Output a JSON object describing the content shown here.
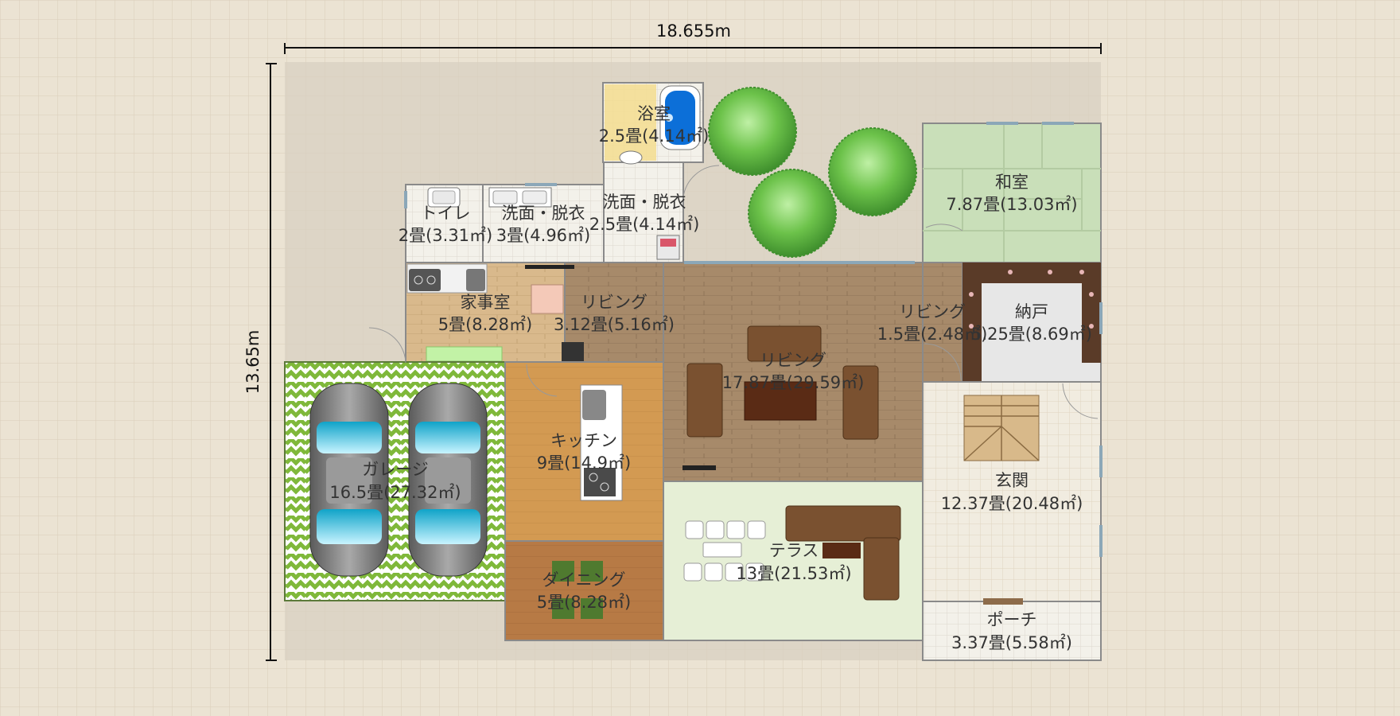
{
  "dimensions": {
    "width_label": "18.655m",
    "height_label": "13.65m"
  },
  "rooms": {
    "bath": {
      "name": "浴室",
      "area": "2.5畳(4.14㎡)"
    },
    "toilet": {
      "name": "トイレ",
      "area": "2畳(3.31㎡)"
    },
    "wash1": {
      "name": "洗面・脱衣",
      "area": "3畳(4.96㎡)"
    },
    "wash2": {
      "name": "洗面・脱衣",
      "area": "2.5畳(4.14㎡)"
    },
    "washitsu": {
      "name": "和室",
      "area": "7.87畳(13.03㎡)"
    },
    "kajishitsu": {
      "name": "家事室",
      "area": "5畳(8.28㎡)"
    },
    "living_small": {
      "name": "リビング",
      "area": "3.12畳(5.16㎡)"
    },
    "living_main": {
      "name": "リビング",
      "area": "17.87畳(29.59㎡)"
    },
    "living_hall": {
      "name": "リビング",
      "area": "1.5畳(2.48㎡)"
    },
    "nando": {
      "name": "納戸",
      "area": "5.25畳(8.69㎡)"
    },
    "garage": {
      "name": "ガレージ",
      "area": "16.5畳(27.32㎡)"
    },
    "kitchen": {
      "name": "キッチン",
      "area": "9畳(14.9㎡)"
    },
    "dining": {
      "name": "ダイニング",
      "area": "5畳(8.28㎡)"
    },
    "terrace": {
      "name": "テラス",
      "area": "13畳(21.53㎡)"
    },
    "genkan": {
      "name": "玄関",
      "area": "12.37畳(20.48㎡)"
    },
    "porch": {
      "name": "ポーチ",
      "area": "3.37畳(5.58㎡)"
    }
  },
  "icons": [
    "tree-icon",
    "car-icon",
    "bathtub-icon",
    "toilet-icon",
    "sink-icon",
    "stove-icon",
    "sofa-icon",
    "table-icon",
    "stairs-icon",
    "tv-icon",
    "washing-machine-icon"
  ],
  "colors": {
    "background": "#ebe3d3",
    "grid": "#d9ceb9",
    "wall": "#8a8a8a",
    "tatami": "#c9dfb9",
    "wood": "#a78a6a",
    "garage_stripe": "#7fb83a",
    "terrace": "#e6efd6",
    "tree": "#6cc24a"
  }
}
